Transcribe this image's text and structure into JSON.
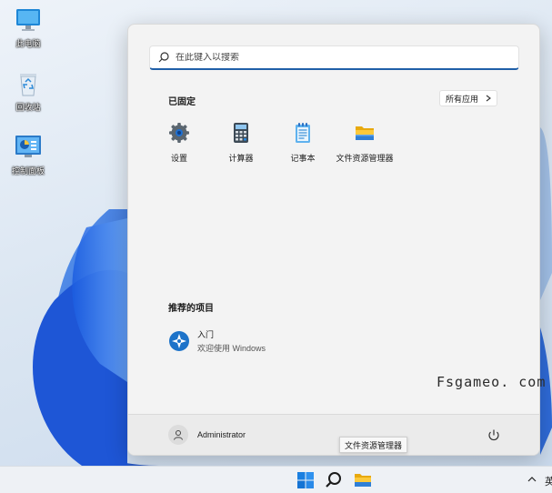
{
  "desktop": {
    "icons": [
      {
        "label": "此电脑",
        "icon": "computer-icon"
      },
      {
        "label": "回收站",
        "icon": "recycle-bin-icon"
      },
      {
        "label": "控制面板",
        "icon": "control-panel-icon"
      }
    ]
  },
  "start_menu": {
    "search": {
      "placeholder": "在此键入以搜索",
      "icon": "search-icon"
    },
    "pinned": {
      "title": "已固定",
      "all_apps_label": "所有应用",
      "apps": [
        {
          "label": "设置",
          "icon": "settings-gear-icon"
        },
        {
          "label": "计算器",
          "icon": "calculator-icon"
        },
        {
          "label": "记事本",
          "icon": "notepad-icon"
        },
        {
          "label": "文件资源管理器",
          "icon": "folder-icon"
        }
      ]
    },
    "recommended": {
      "title": "推荐的项目",
      "items": [
        {
          "title": "入门",
          "subtitle": "欢迎使用 Windows",
          "icon": "get-started-icon"
        }
      ]
    },
    "footer": {
      "user_name": "Administrator",
      "power_icon": "power-icon"
    }
  },
  "tooltip": "文件资源管理器",
  "watermark": "Fsgameo. com",
  "taskbar": {
    "buttons": [
      "windows-start-icon",
      "search-icon",
      "folder-icon"
    ],
    "tray_text": "英"
  },
  "colors": {
    "accent": "#1f5fa8",
    "menu_bg": "#f3f3f3",
    "taskbar_bg": "#eef1f5"
  }
}
